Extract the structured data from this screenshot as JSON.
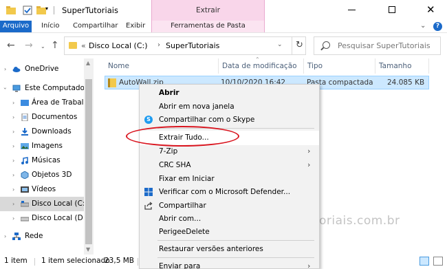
{
  "window": {
    "title": "SuperTutoriais",
    "context_tab_head": "Extrair",
    "close_glyph": "✕"
  },
  "ribbon": {
    "tabs": [
      "Arquivo",
      "Início",
      "Compartilhar",
      "Exibir",
      "Ferramentas de Pasta Compactada"
    ]
  },
  "address": {
    "prefix": "«",
    "path": [
      "Disco Local (C:)",
      "SuperTutoriais"
    ],
    "search_placeholder": "Pesquisar SuperTutoriais"
  },
  "navpane": {
    "items": [
      {
        "label": "OneDrive",
        "icon": "cloud-icon"
      },
      {
        "label": "Este Computador",
        "icon": "computer-icon"
      },
      {
        "label": "Área de Trabalho",
        "icon": "desktop-icon"
      },
      {
        "label": "Documentos",
        "icon": "documents-icon"
      },
      {
        "label": "Downloads",
        "icon": "downloads-icon"
      },
      {
        "label": "Imagens",
        "icon": "pictures-icon"
      },
      {
        "label": "Músicas",
        "icon": "music-icon"
      },
      {
        "label": "Objetos 3D",
        "icon": "objects-3d-icon"
      },
      {
        "label": "Vídeos",
        "icon": "videos-icon"
      },
      {
        "label": "Disco Local (C:)",
        "icon": "drive-icon",
        "selected": true
      },
      {
        "label": "Disco Local (D:)",
        "icon": "drive-icon"
      },
      {
        "label": "Rede",
        "icon": "network-icon"
      }
    ]
  },
  "filelist": {
    "columns": [
      "Nome",
      "Data de modificação",
      "Tipo",
      "Tamanho"
    ],
    "rows": [
      {
        "name": "AutoWall.zip",
        "date": "10/10/2020 16:42",
        "type": "Pasta compactada",
        "size": "24.085 KB"
      }
    ]
  },
  "context_menu": {
    "items": [
      {
        "label": "Abrir"
      },
      {
        "label": "Abrir em nova janela"
      },
      {
        "label": "Compartilhar com o Skype"
      },
      {
        "label": "Extrair Tudo..."
      },
      {
        "label": "7-Zip"
      },
      {
        "label": "CRC SHA"
      },
      {
        "label": "Fixar em Iniciar"
      },
      {
        "label": "Verificar com o Microsoft Defender..."
      },
      {
        "label": "Compartilhar"
      },
      {
        "label": "Abrir com..."
      },
      {
        "label": "PerigeeDelete"
      },
      {
        "label": "Restaurar versões anteriores"
      },
      {
        "label": "Enviar para"
      }
    ]
  },
  "status": {
    "count": "1 item",
    "selected": "1 item selecionado",
    "size": "23,5 MB"
  },
  "watermark": "supertutoriais.com.br",
  "colors": {
    "accent": "#1b6ac9",
    "context_tab": "#f9d6ea",
    "selection": "#cce8ff",
    "highlight_ellipse": "#d9141e"
  }
}
